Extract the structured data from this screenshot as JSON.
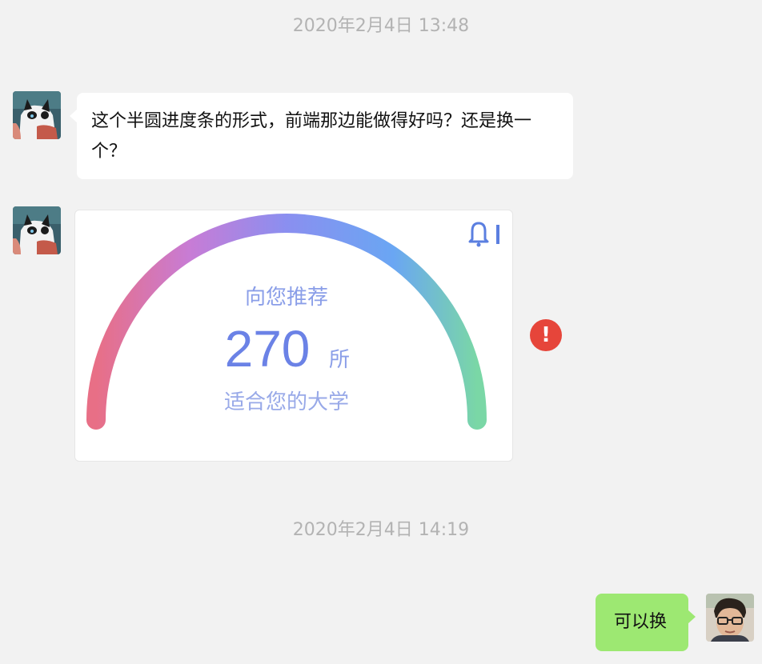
{
  "chat": {
    "timestamp_1": "2020年2月4日 13:48",
    "timestamp_2": "2020年2月4日 14:19",
    "messages": [
      {
        "from": "other",
        "text": "这个半圆进度条的形式，前端那边能做得好吗？还是换一个？"
      },
      {
        "from": "other",
        "type": "image",
        "image": {
          "title": "向您推荐",
          "count": "270",
          "count_unit": "所",
          "subtitle": "适合您的大学",
          "corner_icon": "bell-icon",
          "gauge_colors": [
            "#e86f86",
            "#c77cd6",
            "#8a8ff0",
            "#6aa6f3",
            "#7ad7a6"
          ]
        },
        "status": "failed",
        "status_icon": "exclamation-icon"
      },
      {
        "from": "me",
        "text": "可以换"
      }
    ]
  },
  "colors": {
    "background": "#f2f2f2",
    "incoming_bubble": "#ffffff",
    "outgoing_bubble": "#9de872",
    "timestamp_text": "#b3b3b3",
    "error": "#e6453a",
    "gauge_text": "#6b82e6"
  }
}
